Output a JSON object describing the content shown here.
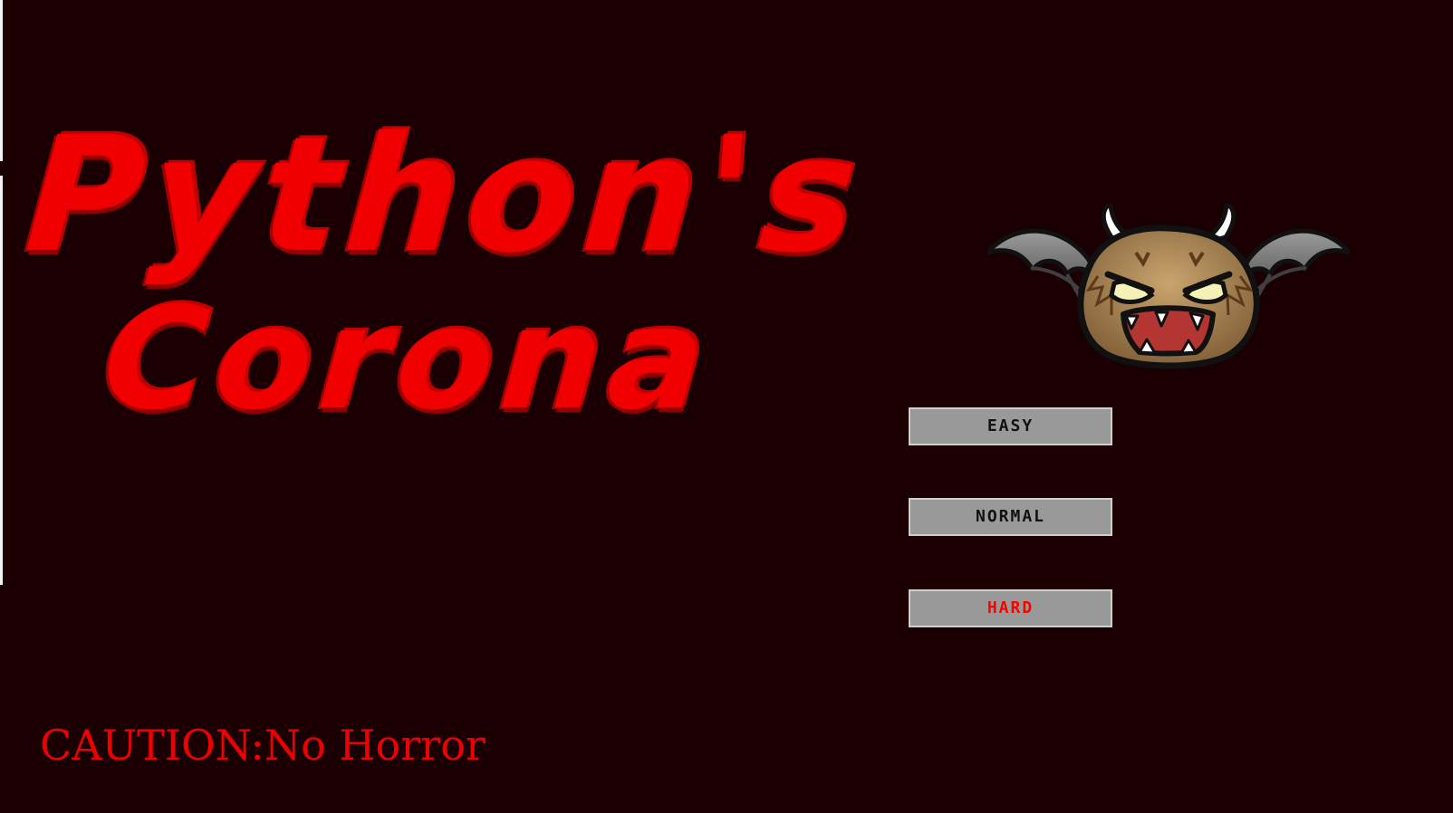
{
  "title": {
    "line1": "Python's",
    "line2": "Corona"
  },
  "menu": {
    "easy_label": "EASY",
    "normal_label": "NORMAL",
    "hard_label": "HARD"
  },
  "caution_text": "CAUTION:No Horror",
  "mascot": {
    "icon": "bat-virus-mascot-icon"
  },
  "colors": {
    "background": "#1a0002",
    "title_red": "#f00000",
    "button_gray": "#999999",
    "hard_red": "#ff0000"
  }
}
